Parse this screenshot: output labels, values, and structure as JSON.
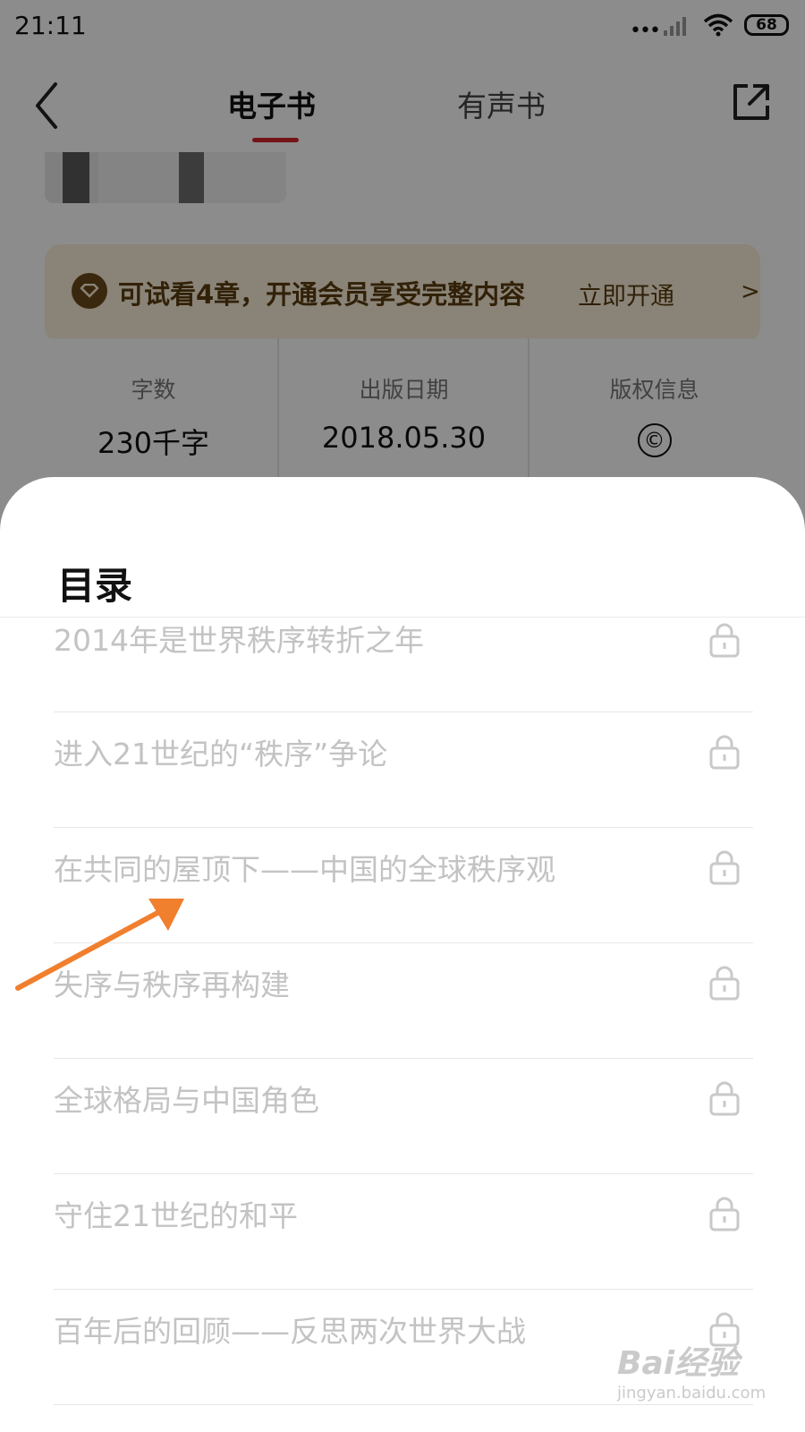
{
  "status_bar": {
    "time": "21:11",
    "battery": "68"
  },
  "header": {
    "tabs": [
      {
        "label": "电子书",
        "active": true
      },
      {
        "label": "有声书",
        "active": false
      }
    ]
  },
  "vip_banner": {
    "text": "可试看4章，开通会员享受完整内容",
    "action": "立即开通"
  },
  "book_info": [
    {
      "label": "字数",
      "value": "230千字"
    },
    {
      "label": "出版日期",
      "value": "2018.05.30"
    },
    {
      "label": "版权信息",
      "value": "©"
    }
  ],
  "toc": {
    "title": "目录",
    "items": [
      "2014年是世界秩序转折之年",
      "进入21世纪的“秩序”争论",
      "在共同的屋顶下——中国的全球秩序观",
      "失序与秩序再构建",
      "全球格局与中国角色",
      "守住21世纪的和平",
      "百年后的回顾——反思两次世界大战"
    ]
  },
  "watermark": {
    "brand": "Bai经验",
    "url": "jingyan.baidu.com"
  },
  "colors": {
    "accent": "#d4262a",
    "vip_bg": "#fbeed9",
    "vip_text": "#5a3d10",
    "arrow": "#f07f2e"
  }
}
